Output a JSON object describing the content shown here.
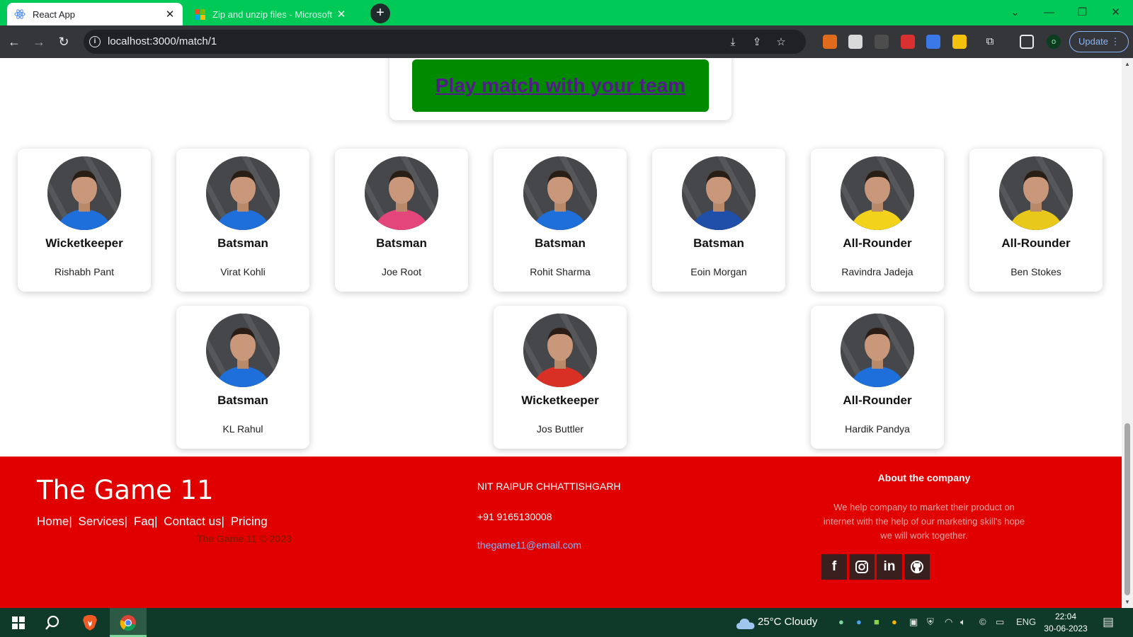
{
  "browser": {
    "tabs": [
      {
        "title": "React App",
        "active": true
      },
      {
        "title": "Zip and unzip files - Microsoft",
        "active": false
      }
    ],
    "url": "localhost:3000/match/1",
    "update_label": "Update",
    "profile_initial": "o"
  },
  "page": {
    "play_button_label": "Play match with your team",
    "players": [
      {
        "role": "Wicketkeeper",
        "name": "Rishabh Pant",
        "jersey": "#1e6fd9"
      },
      {
        "role": "Batsman",
        "name": "Virat Kohli",
        "jersey": "#1e6fd9"
      },
      {
        "role": "Batsman",
        "name": "Joe Root",
        "jersey": "#e4457a"
      },
      {
        "role": "Batsman",
        "name": "Rohit Sharma",
        "jersey": "#1e6fd9"
      },
      {
        "role": "Batsman",
        "name": "Eoin Morgan",
        "jersey": "#1f4fa8"
      },
      {
        "role": "All-Rounder",
        "name": "Ravindra Jadeja",
        "jersey": "#f2d21b"
      },
      {
        "role": "All-Rounder",
        "name": "Ben Stokes",
        "jersey": "#e8c81a"
      },
      {
        "role": "Batsman",
        "name": "KL Rahul",
        "jersey": "#1e6fd9"
      },
      {
        "role": "Wicketkeeper",
        "name": "Jos Buttler",
        "jersey": "#d93025"
      },
      {
        "role": "All-Rounder",
        "name": "Hardik Pandya",
        "jersey": "#1e6fd9"
      }
    ]
  },
  "footer": {
    "brand": "The Game 11",
    "nav": [
      "Home|",
      "Services|",
      "Faq|",
      "Contact us|",
      "Pricing"
    ],
    "copyright": "The Game 11 © 2023",
    "address": "NIT RAIPUR CHHATTISHGARH",
    "phone": "+91 9165130008",
    "email": "thegame11@email.com",
    "about_heading": "About the company",
    "about_text": "We help company to market their product on internet with the help of our marketing skill's hope we will work together.",
    "social": [
      "facebook",
      "instagram",
      "linkedin",
      "github"
    ]
  },
  "taskbar": {
    "weather": "25°C  Cloudy",
    "language": "ENG",
    "time": "22:04",
    "date": "30-06-2023"
  }
}
